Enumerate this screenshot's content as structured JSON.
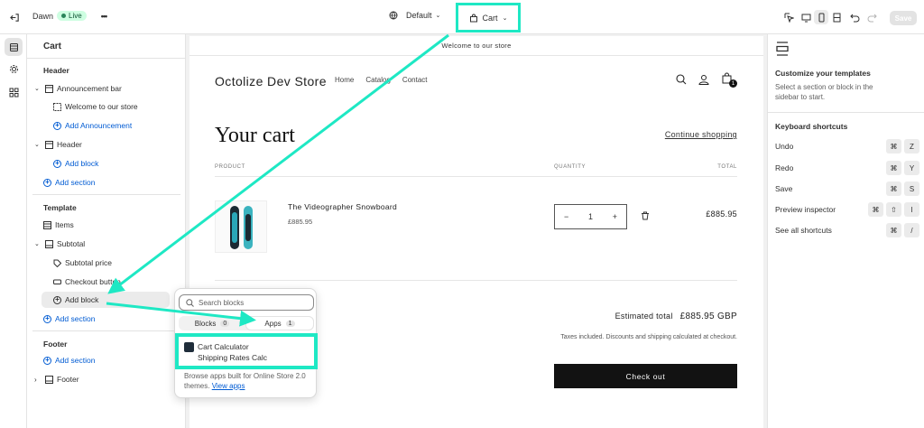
{
  "topbar": {
    "theme_name": "Dawn",
    "live_label": "Live",
    "more_label": "•••",
    "default_label": "Default",
    "template_label": "Cart",
    "save_label": "Save"
  },
  "sidebar": {
    "title": "Cart",
    "header_heading": "Header",
    "announcement_bar": "Announcement bar",
    "welcome_item": "Welcome to our store",
    "add_announcement": "Add Announcement",
    "header_item": "Header",
    "add_block_1": "Add block",
    "add_section_1": "Add section",
    "template_heading": "Template",
    "items_item": "Items",
    "subtotal_item": "Subtotal",
    "subtotal_price": "Subtotal price",
    "checkout_button": "Checkout button",
    "add_block_2": "Add block",
    "add_section_2": "Add section",
    "footer_heading": "Footer",
    "add_section_3": "Add section",
    "footer_item": "Footer"
  },
  "store": {
    "announcement": "Welcome to our store",
    "name": "Octolize Dev Store",
    "nav": [
      "Home",
      "Catalog",
      "Contact"
    ],
    "cart_count": "1",
    "title": "Your cart",
    "continue": "Continue shopping",
    "col_product": "PRODUCT",
    "col_quantity": "QUANTITY",
    "col_total": "TOTAL",
    "product_name": "The Videographer Snowboard",
    "product_price": "£885.95",
    "qty_minus": "−",
    "qty_value": "1",
    "qty_plus": "+",
    "line_total": "£885.95",
    "estimated_label": "Estimated total",
    "estimated_value": "£885.95 GBP",
    "taxes_note": "Taxes included. Discounts and shipping calculated at checkout.",
    "checkout": "Check out"
  },
  "popup": {
    "search_placeholder": "Search blocks",
    "tab_blocks": "Blocks",
    "tab_blocks_count": "0",
    "tab_apps": "Apps",
    "tab_apps_count": "1",
    "app_name": "Cart Calculator",
    "app_block": "Shipping Rates Calc",
    "footer_text": "Browse apps built for Online Store 2.0 themes.",
    "footer_link": "View apps"
  },
  "right_panel": {
    "title": "Customize your templates",
    "desc": "Select a section or block in the sidebar to start.",
    "kb_title": "Keyboard shortcuts",
    "shortcuts": [
      {
        "label": "Undo",
        "keys": [
          "⌘",
          "Z"
        ]
      },
      {
        "label": "Redo",
        "keys": [
          "⌘",
          "Y"
        ]
      },
      {
        "label": "Save",
        "keys": [
          "⌘",
          "S"
        ]
      },
      {
        "label": "Preview inspector",
        "keys": [
          "⌘",
          "⇧",
          "I"
        ]
      },
      {
        "label": "See all shortcuts",
        "keys": [
          "⌘",
          "/"
        ]
      }
    ]
  },
  "colors": {
    "highlight": "#1ee8c4",
    "link": "#005bd3",
    "checkout_bg": "#121212"
  }
}
